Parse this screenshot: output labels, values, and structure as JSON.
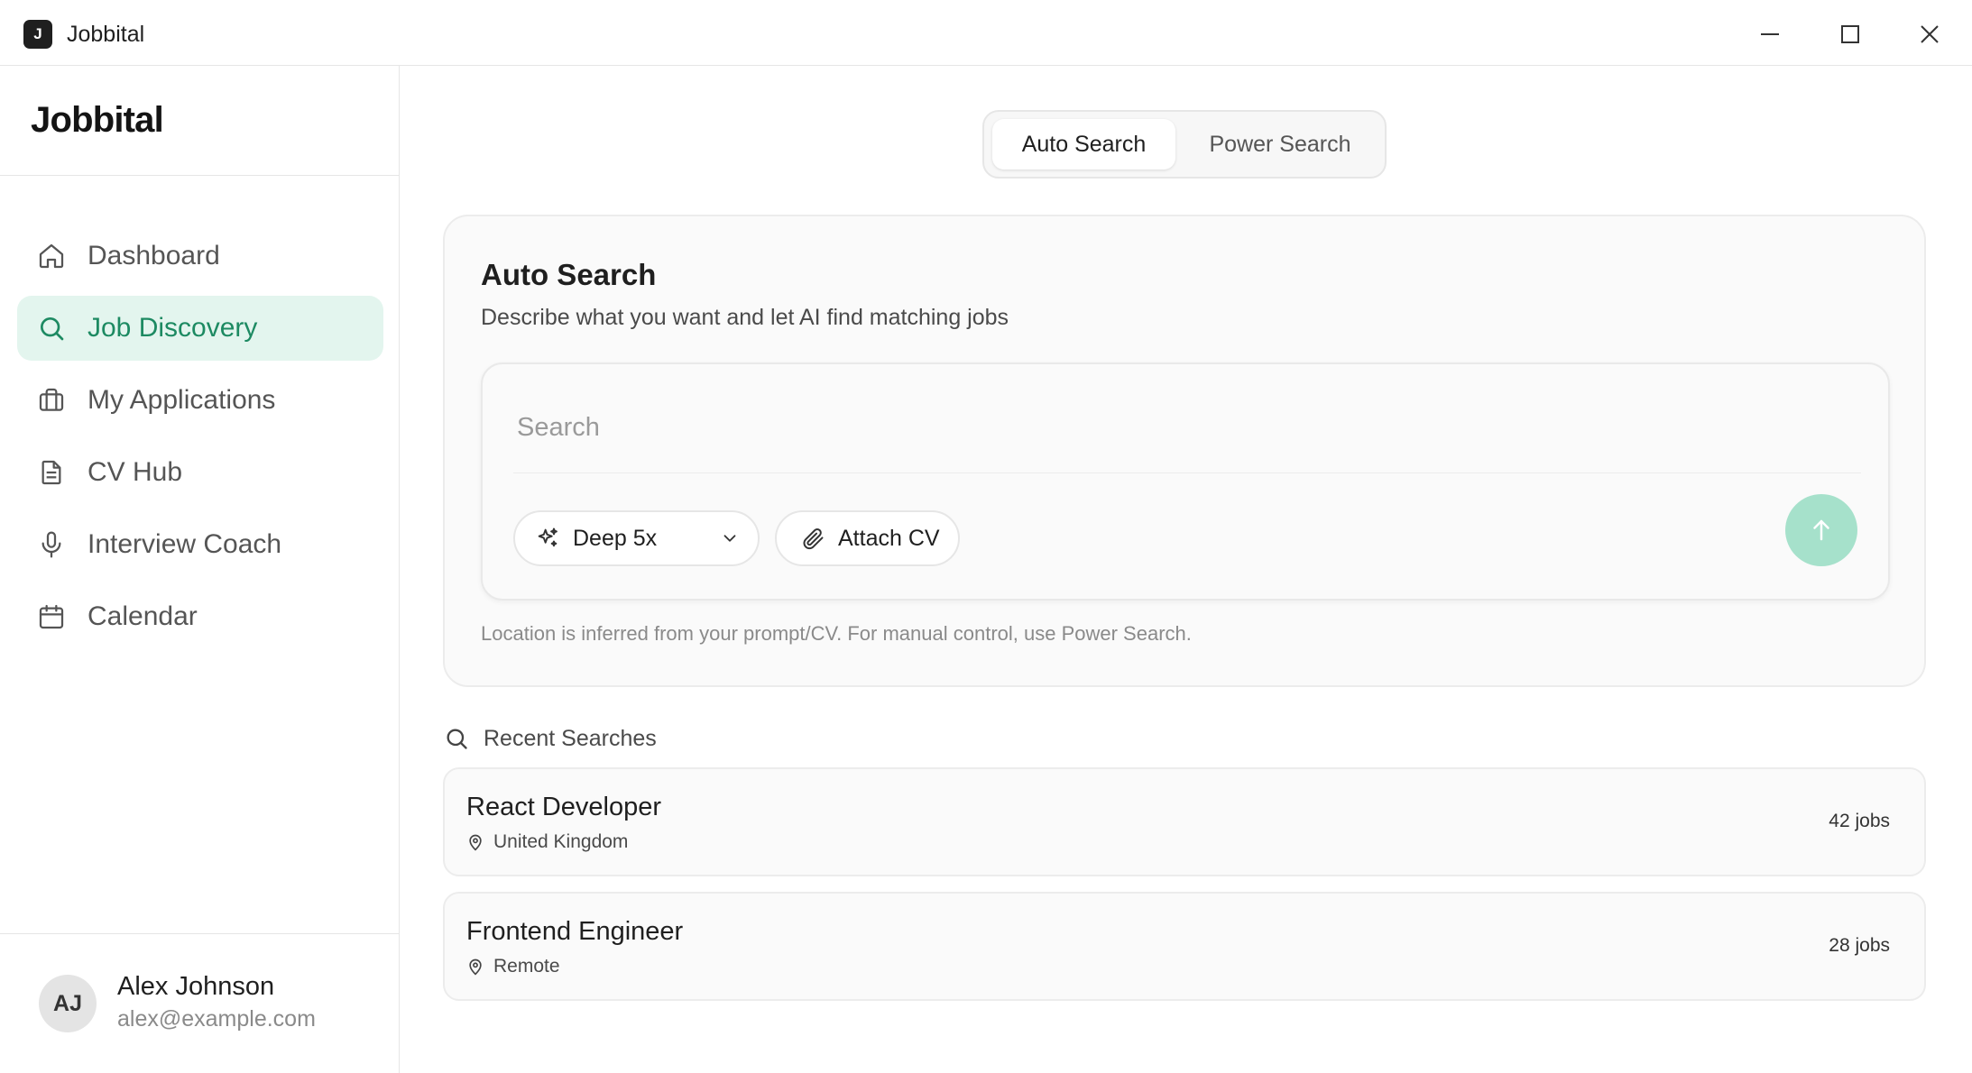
{
  "window": {
    "app_icon_letter": "J",
    "title": "Jobbital"
  },
  "sidebar": {
    "logo": "Jobbital",
    "items": [
      {
        "label": "Dashboard",
        "icon": "home-icon",
        "active": false
      },
      {
        "label": "Job Discovery",
        "icon": "search-icon",
        "active": true
      },
      {
        "label": "My Applications",
        "icon": "briefcase-icon",
        "active": false
      },
      {
        "label": "CV Hub",
        "icon": "document-icon",
        "active": false
      },
      {
        "label": "Interview Coach",
        "icon": "microphone-icon",
        "active": false
      },
      {
        "label": "Calendar",
        "icon": "calendar-icon",
        "active": false
      }
    ],
    "user": {
      "initials": "AJ",
      "name": "Alex Johnson",
      "email": "alex@example.com"
    }
  },
  "tabs": {
    "auto": "Auto Search",
    "power": "Power Search",
    "selected": "Auto Search"
  },
  "auto_search": {
    "title": "Auto Search",
    "subtitle": "Describe what you want and let AI find matching jobs",
    "search_placeholder": "Search",
    "search_value": "",
    "mode_label": "Deep 5x",
    "attach_label": "Attach CV",
    "note": "Location is inferred from your prompt/CV. For manual control, use Power Search."
  },
  "recent": {
    "heading": "Recent Searches",
    "items": [
      {
        "title": "React Developer",
        "location": "United Kingdom",
        "count": "42 jobs"
      },
      {
        "title": "Frontend Engineer",
        "location": "Remote",
        "count": "28 jobs"
      }
    ]
  },
  "colors": {
    "accent": "#1d8a62",
    "accent_bg": "#e3f5ee",
    "send_button": "#a6e1cb"
  }
}
